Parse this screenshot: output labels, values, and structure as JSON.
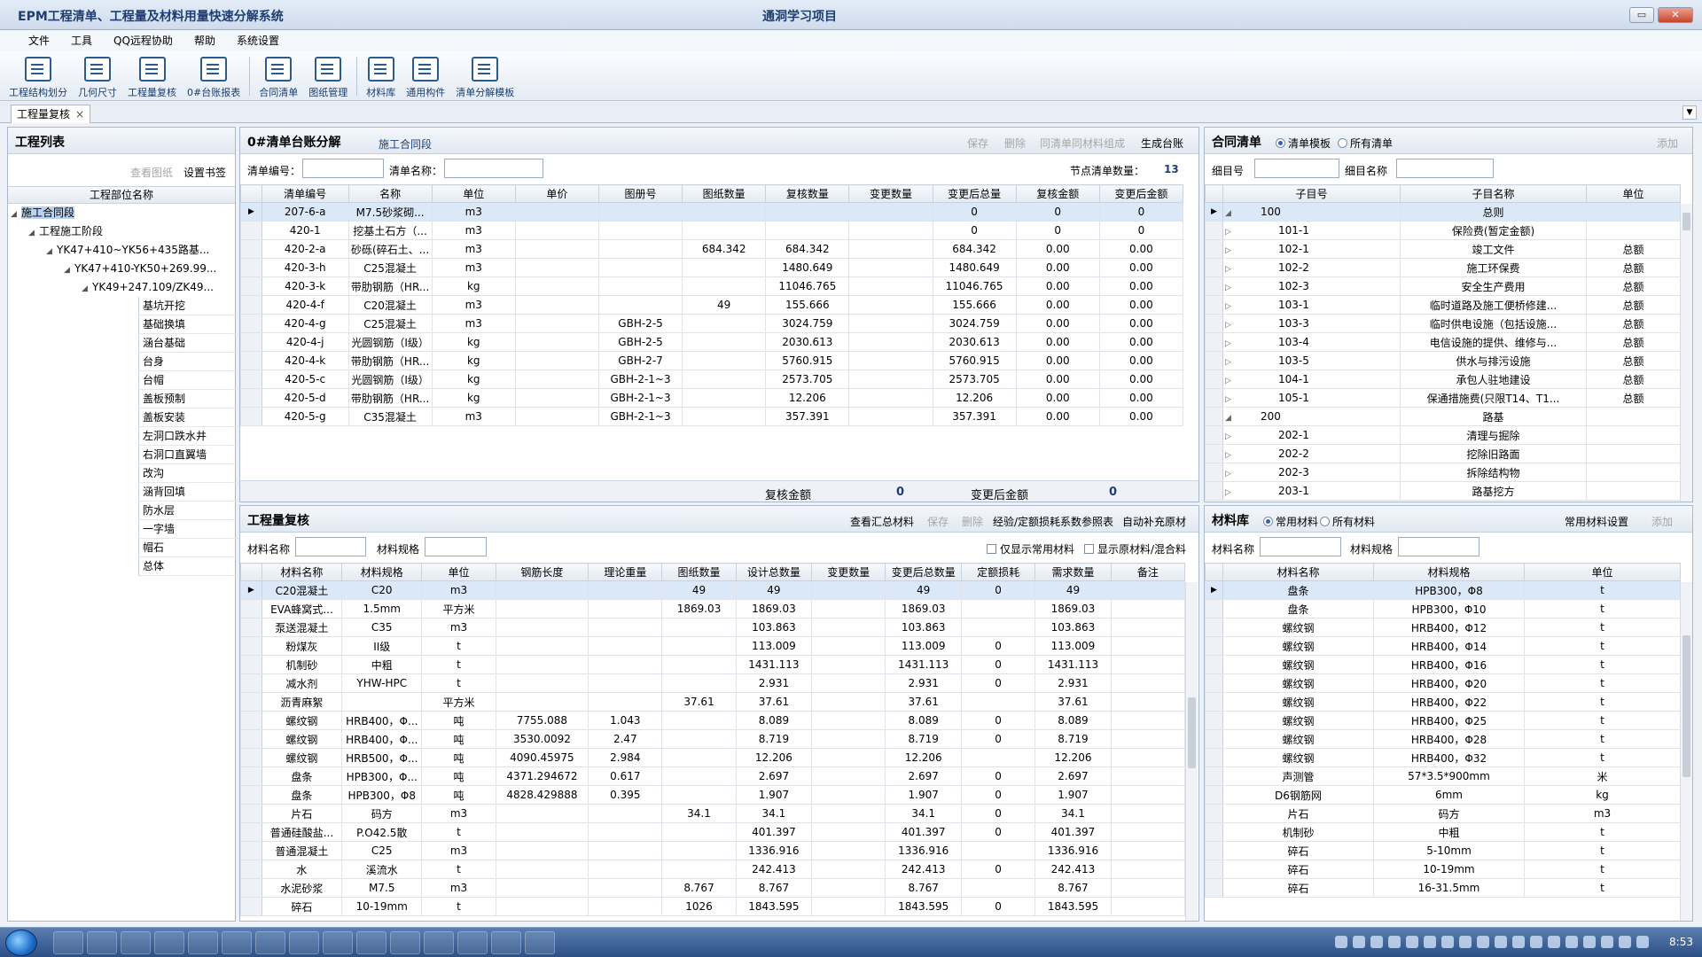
{
  "window": {
    "app_title": "EPM工程清单、工程量及材料用量快速分解系统",
    "project_title": "通洞学习项目",
    "min_label": "▭",
    "max_label": "",
    "close_label": "✕"
  },
  "menu": [
    "文件",
    "工具",
    "QQ远程协助",
    "帮助",
    "系统设置"
  ],
  "toolbar": [
    "工程结构划分",
    "几何尺寸",
    "工程量复核",
    "0#台账报表",
    "合同清单",
    "图纸管理",
    "材料库",
    "通用构件",
    "清单分解模板"
  ],
  "doc_tab": {
    "label": "工程量复核",
    "close": "×"
  },
  "left": {
    "title": "工程列表",
    "btn_view": "查看图纸",
    "btn_bookmark": "设置书签",
    "col": "工程部位名称",
    "tree": [
      {
        "label": "施工合同段",
        "level": 0,
        "sel": true
      },
      {
        "label": "工程施工阶段",
        "level": 1
      },
      {
        "label": "YK47+410~YK56+435路基...",
        "level": 2
      },
      {
        "label": "YK47+410-YK50+269.99...",
        "level": 3
      },
      {
        "label": "YK49+247.109/ZK49...",
        "level": 4
      }
    ],
    "leaves": [
      "基坑开挖",
      "基础换填",
      "涵台基础",
      "台身",
      "台帽",
      "盖板预制",
      "盖板安装",
      "左洞口跌水井",
      "右洞口直翼墙",
      "改沟",
      "涵背回填",
      "防水层",
      "一字墙",
      "帽石",
      "总体"
    ]
  },
  "ledger": {
    "title": "0#清单台账分解",
    "subtitle": "施工合同段",
    "actions": [
      "保存",
      "删除",
      "同清单同材料组成",
      "生成台账"
    ],
    "f_code": "清单编号：",
    "f_name": "清单名称：",
    "count_label": "节点清单数量：",
    "count": "13",
    "cols": [
      "清单编号",
      "名称",
      "单位",
      "单价",
      "图册号",
      "图纸数量",
      "复核数量",
      "变更数量",
      "变更后总量",
      "复核金额",
      "变更后金额"
    ],
    "rows": [
      [
        "207-6-a",
        "M7.5砂浆砌...",
        "m3",
        "",
        "",
        "",
        "",
        "",
        "0",
        "0",
        "0"
      ],
      [
        "420-1",
        "挖基土石方（...",
        "m3",
        "",
        "",
        "",
        "",
        "",
        "0",
        "0",
        "0"
      ],
      [
        "420-2-a",
        "砂砾(碎石土、...",
        "m3",
        "",
        "",
        "684.342",
        "684.342",
        "",
        "684.342",
        "0.00",
        "0.00"
      ],
      [
        "420-3-h",
        "C25混凝土",
        "m3",
        "",
        "",
        "",
        "1480.649",
        "",
        "1480.649",
        "0.00",
        "0.00"
      ],
      [
        "420-3-k",
        "带肋钢筋（HR...",
        "kg",
        "",
        "",
        "",
        "11046.765",
        "",
        "11046.765",
        "0.00",
        "0.00"
      ],
      [
        "420-4-f",
        "C20混凝土",
        "m3",
        "",
        "",
        "49",
        "155.666",
        "",
        "155.666",
        "0.00",
        "0.00"
      ],
      [
        "420-4-g",
        "C25混凝土",
        "m3",
        "",
        "GBH-2-5",
        "",
        "3024.759",
        "",
        "3024.759",
        "0.00",
        "0.00"
      ],
      [
        "420-4-j",
        "光圆钢筋（I级）",
        "kg",
        "",
        "GBH-2-5",
        "",
        "2030.613",
        "",
        "2030.613",
        "0.00",
        "0.00"
      ],
      [
        "420-4-k",
        "带肋钢筋（HR...",
        "kg",
        "",
        "GBH-2-7",
        "",
        "5760.915",
        "",
        "5760.915",
        "0.00",
        "0.00"
      ],
      [
        "420-5-c",
        "光圆钢筋（I级）",
        "kg",
        "",
        "GBH-2-1~3",
        "",
        "2573.705",
        "",
        "2573.705",
        "0.00",
        "0.00"
      ],
      [
        "420-5-d",
        "带肋钢筋（HR...",
        "kg",
        "",
        "GBH-2-1~3",
        "",
        "12.206",
        "",
        "12.206",
        "0.00",
        "0.00"
      ],
      [
        "420-5-g",
        "C35混凝土",
        "m3",
        "",
        "GBH-2-1~3",
        "",
        "357.391",
        "",
        "357.391",
        "0.00",
        "0.00"
      ]
    ],
    "foot_review": "复核金额",
    "foot_review_val": "0",
    "foot_change": "变更后金额",
    "foot_change_val": "0"
  },
  "contract": {
    "title": "合同清单",
    "r1": "清单模板",
    "r2": "所有清单",
    "add": "添加",
    "f_code": "细目号",
    "f_name": "细目名称",
    "cols": [
      "子目号",
      "子目名称",
      "单位"
    ],
    "rows": [
      [
        "100",
        "总则",
        "",
        0
      ],
      [
        "101-1",
        "保险费(暂定金额)",
        "",
        1
      ],
      [
        "102-1",
        "竣工文件",
        "总额",
        1
      ],
      [
        "102-2",
        "施工环保费",
        "总额",
        1
      ],
      [
        "102-3",
        "安全生产费用",
        "总额",
        1
      ],
      [
        "103-1",
        "临时道路及施工便桥修建...",
        "总额",
        1
      ],
      [
        "103-3",
        "临时供电设施（包括设施...",
        "总额",
        1
      ],
      [
        "103-4",
        "电信设施的提供、维修与...",
        "总额",
        1
      ],
      [
        "103-5",
        "供水与排污设施",
        "总额",
        1
      ],
      [
        "104-1",
        "承包人驻地建设",
        "总额",
        1
      ],
      [
        "105-1",
        "保通措施费(只限T14、T1...",
        "总额",
        1
      ],
      [
        "200",
        "路基",
        "",
        0
      ],
      [
        "202-1",
        "清理与掘除",
        "",
        1
      ],
      [
        "202-2",
        "挖除旧路面",
        "",
        1
      ],
      [
        "202-3",
        "拆除结构物",
        "",
        1
      ],
      [
        "203-1",
        "路基挖方",
        "",
        1
      ]
    ]
  },
  "review": {
    "title": "工程量复核",
    "actions": [
      "查看汇总材料",
      "保存",
      "删除",
      "经验/定额损耗系数参照表",
      "自动补充原材"
    ],
    "f_mat": "材料名称",
    "f_spec": "材料规格",
    "chk1": "仅显示常用材料",
    "chk2": "显示原材料/混合料",
    "cols": [
      "材料名称",
      "材料规格",
      "单位",
      "钢筋长度",
      "理论重量",
      "图纸数量",
      "设计总数量",
      "变更数量",
      "变更后总数量",
      "定额损耗",
      "需求数量",
      "备注"
    ],
    "rows": [
      [
        "C20混凝土",
        "C20",
        "m3",
        "",
        "",
        "49",
        "49",
        "",
        "49",
        "0",
        "49",
        ""
      ],
      [
        "EVA蜂窝式...",
        "1.5mm",
        "平方米",
        "",
        "",
        "1869.03",
        "1869.03",
        "",
        "1869.03",
        "",
        "1869.03",
        ""
      ],
      [
        "泵送混凝土",
        "C35",
        "m3",
        "",
        "",
        "",
        "103.863",
        "",
        "103.863",
        "",
        "103.863",
        ""
      ],
      [
        "粉煤灰",
        "II级",
        "t",
        "",
        "",
        "",
        "113.009",
        "",
        "113.009",
        "0",
        "113.009",
        ""
      ],
      [
        "机制砂",
        "中粗",
        "t",
        "",
        "",
        "",
        "1431.113",
        "",
        "1431.113",
        "0",
        "1431.113",
        ""
      ],
      [
        "减水剂",
        "YHW-HPC",
        "t",
        "",
        "",
        "",
        "2.931",
        "",
        "2.931",
        "0",
        "2.931",
        ""
      ],
      [
        "沥青麻絮",
        "",
        "平方米",
        "",
        "",
        "37.61",
        "37.61",
        "",
        "37.61",
        "",
        "37.61",
        ""
      ],
      [
        "螺纹钢",
        "HRB400，Φ...",
        "吨",
        "7755.088",
        "1.043",
        "",
        "8.089",
        "",
        "8.089",
        "0",
        "8.089",
        ""
      ],
      [
        "螺纹钢",
        "HRB400，Φ...",
        "吨",
        "3530.0092",
        "2.47",
        "",
        "8.719",
        "",
        "8.719",
        "0",
        "8.719",
        ""
      ],
      [
        "螺纹钢",
        "HRB500，Φ...",
        "吨",
        "4090.45975",
        "2.984",
        "",
        "12.206",
        "",
        "12.206",
        "",
        "12.206",
        ""
      ],
      [
        "盘条",
        "HPB300，Φ...",
        "吨",
        "4371.294672",
        "0.617",
        "",
        "2.697",
        "",
        "2.697",
        "0",
        "2.697",
        ""
      ],
      [
        "盘条",
        "HPB300，Φ8",
        "吨",
        "4828.429888",
        "0.395",
        "",
        "1.907",
        "",
        "1.907",
        "0",
        "1.907",
        ""
      ],
      [
        "片石",
        "码方",
        "m3",
        "",
        "",
        "34.1",
        "34.1",
        "",
        "34.1",
        "0",
        "34.1",
        ""
      ],
      [
        "普通硅酸盐...",
        "P.O42.5散",
        "t",
        "",
        "",
        "",
        "401.397",
        "",
        "401.397",
        "0",
        "401.397",
        ""
      ],
      [
        "普通混凝土",
        "C25",
        "m3",
        "",
        "",
        "",
        "1336.916",
        "",
        "1336.916",
        "",
        "1336.916",
        ""
      ],
      [
        "水",
        "溪流水",
        "t",
        "",
        "",
        "",
        "242.413",
        "",
        "242.413",
        "0",
        "242.413",
        ""
      ],
      [
        "水泥砂浆",
        "M7.5",
        "m3",
        "",
        "",
        "8.767",
        "8.767",
        "",
        "8.767",
        "",
        "8.767",
        ""
      ],
      [
        "碎石",
        "10-19mm",
        "t",
        "",
        "",
        "1026",
        "1843.595",
        "",
        "1843.595",
        "0",
        "1843.595",
        ""
      ]
    ]
  },
  "materials": {
    "title": "材料库",
    "r1": "常用材料",
    "r2": "所有材料",
    "settings": "常用材料设置",
    "add": "添加",
    "f_mat": "材料名称",
    "f_spec": "材料规格",
    "cols": [
      "材料名称",
      "材料规格",
      "单位"
    ],
    "rows": [
      [
        "盘条",
        "HPB300，Φ8",
        "t"
      ],
      [
        "盘条",
        "HPB300，Φ10",
        "t"
      ],
      [
        "螺纹钢",
        "HRB400，Φ12",
        "t"
      ],
      [
        "螺纹钢",
        "HRB400，Φ14",
        "t"
      ],
      [
        "螺纹钢",
        "HRB400，Φ16",
        "t"
      ],
      [
        "螺纹钢",
        "HRB400，Φ20",
        "t"
      ],
      [
        "螺纹钢",
        "HRB400，Φ22",
        "t"
      ],
      [
        "螺纹钢",
        "HRB400，Φ25",
        "t"
      ],
      [
        "螺纹钢",
        "HRB400，Φ28",
        "t"
      ],
      [
        "螺纹钢",
        "HRB400，Φ32",
        "t"
      ],
      [
        "声测管",
        "57*3.5*900mm",
        "米"
      ],
      [
        "D6钢筋网",
        "6mm",
        "kg"
      ],
      [
        "片石",
        "码方",
        "m3"
      ],
      [
        "机制砂",
        "中粗",
        "t"
      ],
      [
        "碎石",
        "5-10mm",
        "t"
      ],
      [
        "碎石",
        "10-19mm",
        "t"
      ],
      [
        "碎石",
        "16-31.5mm",
        "t"
      ]
    ]
  },
  "taskbar": {
    "clock": "8:53"
  }
}
